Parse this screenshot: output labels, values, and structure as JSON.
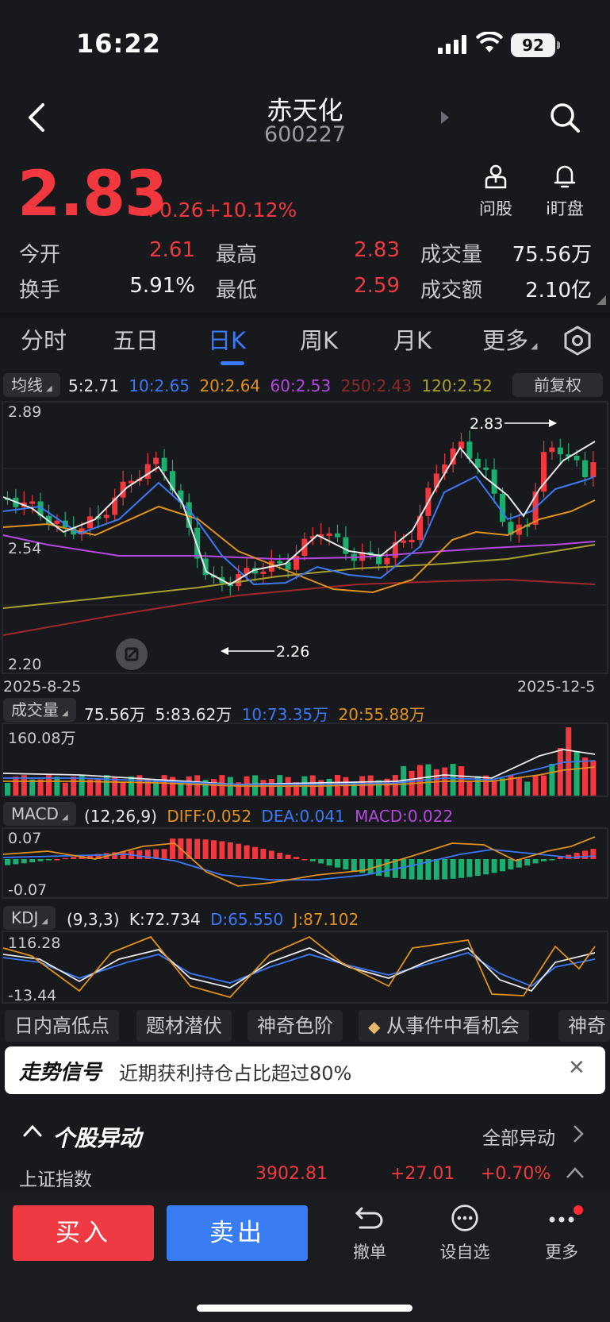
{
  "status": {
    "time": "16:22",
    "battery": "92"
  },
  "header": {
    "name": "赤天化",
    "code": "600227"
  },
  "quote": {
    "price": "2.83",
    "change": "+0.26",
    "change_pct": "+10.12%",
    "ask_label": "问股",
    "watch_label": "i盯盘",
    "stats": [
      {
        "label": "今开",
        "value": "2.61",
        "color": "#f0383e"
      },
      {
        "label": "换手",
        "value": "5.91%",
        "color": "#f1f2f5"
      },
      {
        "label": "最高",
        "value": "2.83",
        "color": "#f0383e"
      },
      {
        "label": "最低",
        "value": "2.59",
        "color": "#f0383e"
      },
      {
        "label": "成交量",
        "value": "75.56万",
        "color": "#f1f2f5"
      },
      {
        "label": "成交额",
        "value": "2.10亿",
        "color": "#f1f2f5"
      }
    ]
  },
  "tabs": [
    {
      "label": "分时"
    },
    {
      "label": "五日"
    },
    {
      "label": "日K"
    },
    {
      "label": "周K"
    },
    {
      "label": "月K"
    },
    {
      "label": "更多"
    }
  ],
  "active_tab": "日K",
  "ma_row": {
    "pill": "均线",
    "items": [
      {
        "text": "5:2.71",
        "color": "#e8e8ea"
      },
      {
        "text": "10:2.65",
        "color": "#3b79f6"
      },
      {
        "text": "20:2.64",
        "color": "#e0901d"
      },
      {
        "text": "60:2.53",
        "color": "#b548e0"
      },
      {
        "text": "250:2.43",
        "color": "#8c2a2a"
      },
      {
        "text": "120:2.52",
        "color": "#a7a02e"
      }
    ],
    "adjust": "前复权"
  },
  "kline": {
    "y_top": "2.89",
    "y_mid": "2.54",
    "y_bottom": "2.20",
    "max_marker": "2.83",
    "min_marker": "2.26",
    "date_start": "2025-8-25",
    "date_end": "2025-12-5"
  },
  "volume_row": {
    "pill": "成交量",
    "items": [
      {
        "text": "75.56万",
        "color": "#e8e8ea"
      },
      {
        "text": "5:83.62万",
        "color": "#e8e8ea"
      },
      {
        "text": "10:73.35万",
        "color": "#3b79f6"
      },
      {
        "text": "20:55.88万",
        "color": "#e0901d"
      }
    ],
    "y_top": "160.08万"
  },
  "macd_row": {
    "pill": "MACD",
    "items": [
      {
        "text": "(12,26,9)",
        "color": "#e8e8ea"
      },
      {
        "text": "DIFF:0.052",
        "color": "#e0901d"
      },
      {
        "text": "DEA:0.041",
        "color": "#3b79f6"
      },
      {
        "text": "MACD:0.022",
        "color": "#b548e0"
      }
    ],
    "y_top": "0.07",
    "y_bottom": "-0.07"
  },
  "kdj_row": {
    "pill": "KDJ",
    "items": [
      {
        "text": "(9,3,3)",
        "color": "#e8e8ea"
      },
      {
        "text": "K:72.734",
        "color": "#e8e8ea"
      },
      {
        "text": "D:65.550",
        "color": "#3b79f6"
      },
      {
        "text": "J:87.102",
        "color": "#e0901d"
      }
    ],
    "y_top": "116.28",
    "y_bottom": "-13.44"
  },
  "features": [
    "日内高低点",
    "题材潜伏",
    "神奇色阶",
    "从事件中看机会",
    "神奇"
  ],
  "signal": {
    "title": "走势信号",
    "text": "近期获利持仓占比超过80%"
  },
  "anomaly": {
    "title": "个股异动",
    "all": "全部异动"
  },
  "index": {
    "name": "上证指数",
    "value": "3902.81",
    "change": "+27.01",
    "pct": "+0.70%"
  },
  "bottom": {
    "buy": "买入",
    "sell": "卖出",
    "cancel": "撤单",
    "add": "设自选",
    "more": "更多"
  },
  "colors": {
    "up": "#f0383e",
    "down": "#1bae6e",
    "accent": "#3b79f6"
  }
}
